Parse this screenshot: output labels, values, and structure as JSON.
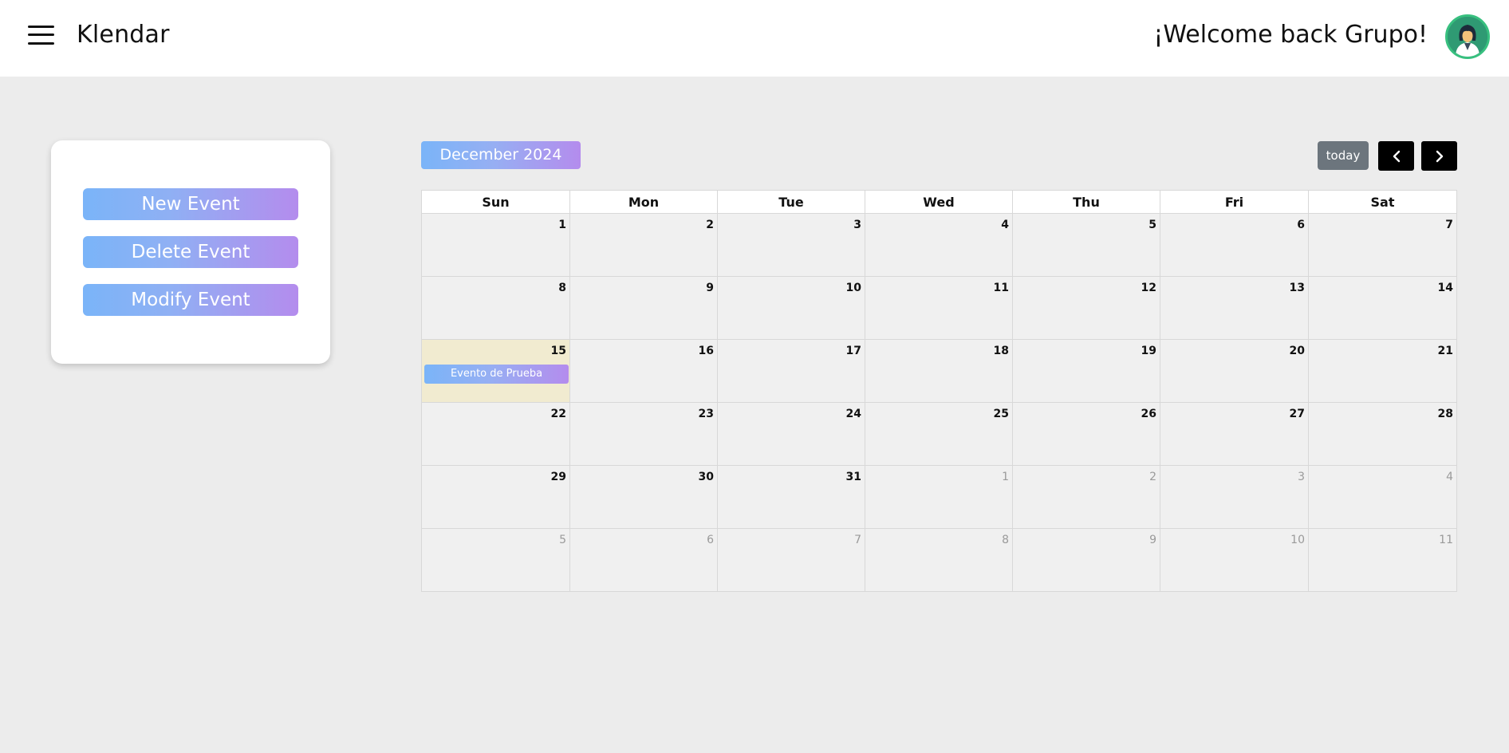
{
  "app": {
    "name": "Klendar",
    "welcome": "¡Welcome back Grupo!"
  },
  "sidebar": {
    "buttons": [
      {
        "label": "New Event"
      },
      {
        "label": "Delete Event"
      },
      {
        "label": "Modify Event"
      }
    ]
  },
  "toolbar": {
    "month_title": "December 2024",
    "today_label": "today",
    "prev_icon": "chevron-left-icon",
    "next_icon": "chevron-right-icon"
  },
  "calendar": {
    "weekdays": [
      "Sun",
      "Mon",
      "Tue",
      "Wed",
      "Thu",
      "Fri",
      "Sat"
    ],
    "today_date": "15",
    "weeks": [
      [
        {
          "d": "1"
        },
        {
          "d": "2"
        },
        {
          "d": "3"
        },
        {
          "d": "4"
        },
        {
          "d": "5"
        },
        {
          "d": "6"
        },
        {
          "d": "7"
        }
      ],
      [
        {
          "d": "8"
        },
        {
          "d": "9"
        },
        {
          "d": "10"
        },
        {
          "d": "11"
        },
        {
          "d": "12"
        },
        {
          "d": "13"
        },
        {
          "d": "14"
        }
      ],
      [
        {
          "d": "15",
          "today": true
        },
        {
          "d": "16"
        },
        {
          "d": "17"
        },
        {
          "d": "18"
        },
        {
          "d": "19"
        },
        {
          "d": "20"
        },
        {
          "d": "21"
        }
      ],
      [
        {
          "d": "22"
        },
        {
          "d": "23"
        },
        {
          "d": "24"
        },
        {
          "d": "25"
        },
        {
          "d": "26"
        },
        {
          "d": "27"
        },
        {
          "d": "28"
        }
      ],
      [
        {
          "d": "29"
        },
        {
          "d": "30"
        },
        {
          "d": "31"
        },
        {
          "d": "1",
          "other": true
        },
        {
          "d": "2",
          "other": true
        },
        {
          "d": "3",
          "other": true
        },
        {
          "d": "4",
          "other": true
        }
      ],
      [
        {
          "d": "5",
          "other": true
        },
        {
          "d": "6",
          "other": true
        },
        {
          "d": "7",
          "other": true
        },
        {
          "d": "8",
          "other": true
        },
        {
          "d": "9",
          "other": true
        },
        {
          "d": "10",
          "other": true
        },
        {
          "d": "11",
          "other": true
        }
      ]
    ],
    "events": [
      {
        "title": "Evento de Prueba",
        "date": "15"
      }
    ]
  },
  "colors": {
    "gradient_start": "#7ab4f8",
    "gradient_end": "#b48ced",
    "today_bg": "#f1ebd0",
    "nav_button": "#000000",
    "today_button": "#6c757d"
  }
}
